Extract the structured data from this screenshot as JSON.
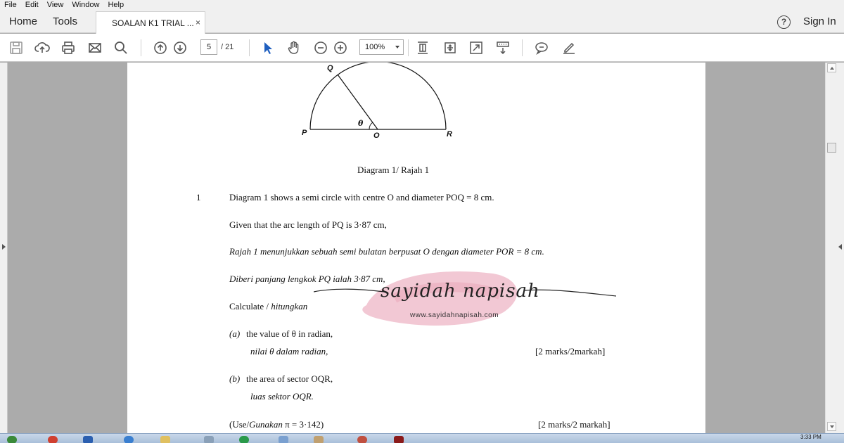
{
  "menu": [
    "File",
    "Edit",
    "View",
    "Window",
    "Help"
  ],
  "nav": {
    "home": "Home",
    "tools": "Tools",
    "sign_in": "Sign In",
    "help_glyph": "?"
  },
  "tab": {
    "title": "SOALAN K1 TRIAL ...",
    "close": "×"
  },
  "toolbar": {
    "page_current": "5",
    "page_total": "/ 21",
    "zoom": "100%",
    "icons": [
      "save-icon",
      "upload-icon",
      "print-icon",
      "email-icon",
      "search-icon",
      "prev-page-icon",
      "next-page-icon",
      "select-cursor-icon",
      "hand-icon",
      "zoom-out-icon",
      "zoom-in-icon",
      "fit-page-icon",
      "rotate-icon",
      "full-screen-icon",
      "scroll-mode-icon",
      "comment-icon",
      "sign-icon"
    ]
  },
  "diagram": {
    "labels": {
      "q": "Q",
      "p": "P",
      "o": "O",
      "r": "R",
      "theta": "θ"
    },
    "caption": "Diagram 1/ Rajah 1"
  },
  "question": {
    "number": "1",
    "line1": "Diagram 1 shows a semi circle with centre O and diameter POQ = 8 cm.",
    "line2": "Given that the arc length of PQ is 3·87 cm,",
    "line3": "Rajah 1 menunjukkan sebuah semi bulatan berpusat O dengan diameter POR = 8 cm.",
    "line4": "Diberi panjang lengkok PQ ialah 3·87 cm,",
    "calc_en": "Calculate /",
    "calc_ms": "hitungkan",
    "a_label": "(a)",
    "a_en": "the value of θ in radian,",
    "a_ms": "nilai θ dalam radian,",
    "a_marks": "[2 marks/2markah]",
    "b_label": "(b)",
    "b_en": "the area of sector OQR,",
    "b_ms": "luas sektor OQR.",
    "use_en": "(Use/",
    "use_ms": "Gunakan",
    "use_val": "π = 3·142)",
    "b_marks": "[2 marks/2 markah]"
  },
  "watermark": {
    "name": "sayidah napisah",
    "url": "www.sayidahnapisah.com"
  },
  "taskbar": {
    "clock": "3:33 PM"
  },
  "colors": {
    "accent_select": "#1f5fbf",
    "watermark_pink": "#e79bb0",
    "page_bg": "#ffffff",
    "viewer_bg": "#ababab"
  }
}
